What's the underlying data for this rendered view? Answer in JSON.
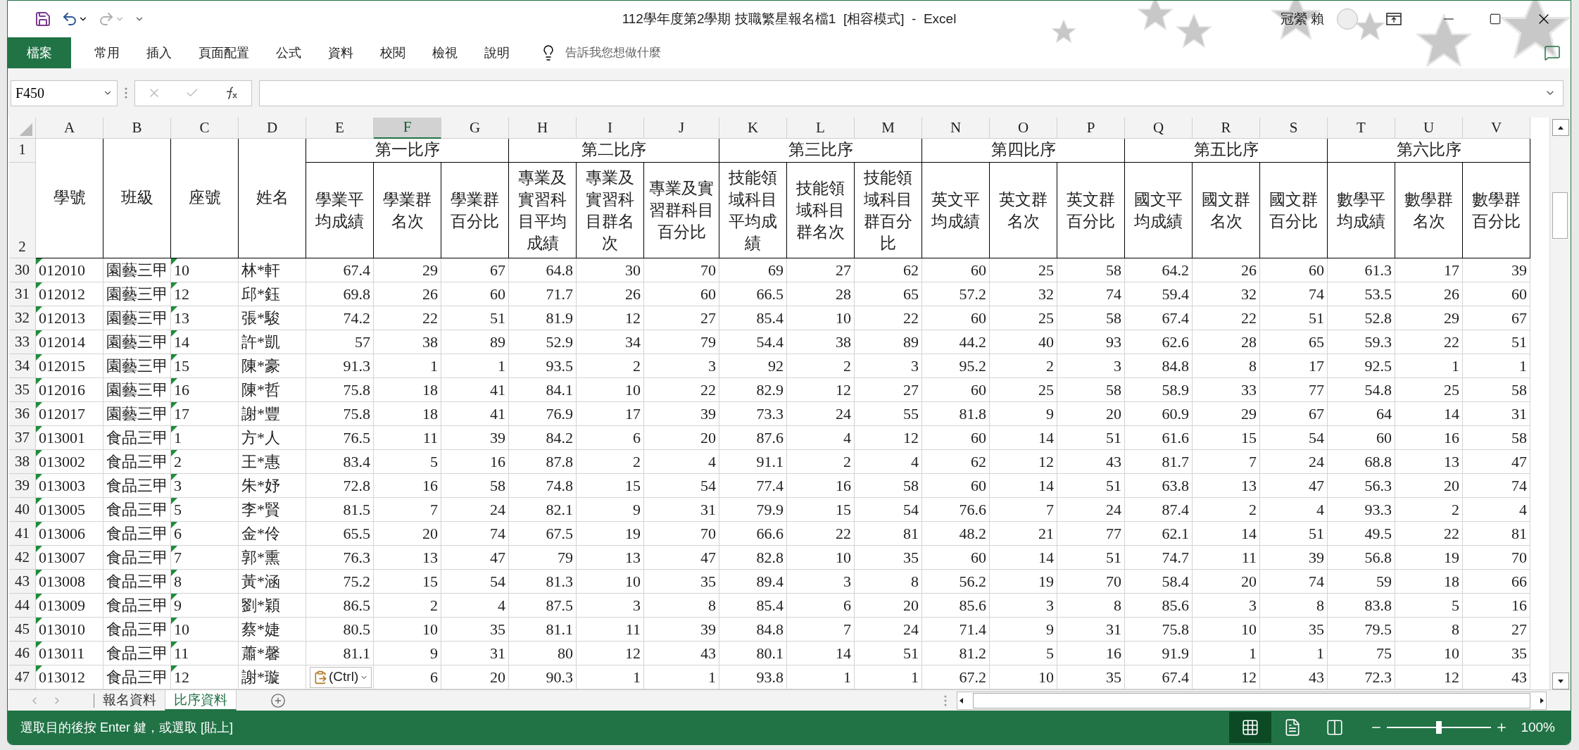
{
  "title_bar": {
    "title": "112學年度第2學期 技職繁星報名檔1  [相容模式]  -  Excel",
    "user": "冠縈 賴"
  },
  "ribbon_tabs": [
    {
      "label": "檔案",
      "kind": "file"
    },
    {
      "label": "常用",
      "kind": "tab"
    },
    {
      "label": "插入",
      "kind": "tab"
    },
    {
      "label": "頁面配置",
      "kind": "tab"
    },
    {
      "label": "公式",
      "kind": "tab"
    },
    {
      "label": "資料",
      "kind": "tab"
    },
    {
      "label": "校閱",
      "kind": "tab"
    },
    {
      "label": "檢視",
      "kind": "tab"
    },
    {
      "label": "說明",
      "kind": "tab"
    }
  ],
  "tell_me": {
    "placeholder": "告訴我您想做什麼"
  },
  "formula_bar": {
    "name_box": "F450"
  },
  "sheet": {
    "columns": [
      {
        "letter": "A",
        "selected": false,
        "kind": "text",
        "flagged": true
      },
      {
        "letter": "B",
        "selected": false,
        "kind": "text",
        "flagged": false
      },
      {
        "letter": "C",
        "selected": false,
        "kind": "text",
        "flagged": true
      },
      {
        "letter": "D",
        "selected": false,
        "kind": "text",
        "flagged": false
      },
      {
        "letter": "E",
        "selected": false,
        "kind": "number",
        "flagged": false
      },
      {
        "letter": "F",
        "selected": true,
        "kind": "number",
        "flagged": false
      },
      {
        "letter": "G",
        "selected": false,
        "kind": "number",
        "flagged": false
      },
      {
        "letter": "H",
        "selected": false,
        "kind": "number",
        "flagged": false
      },
      {
        "letter": "I",
        "selected": false,
        "kind": "number",
        "flagged": false
      },
      {
        "letter": "J",
        "selected": false,
        "kind": "number",
        "flagged": false
      },
      {
        "letter": "K",
        "selected": false,
        "kind": "number",
        "flagged": false
      },
      {
        "letter": "L",
        "selected": false,
        "kind": "number",
        "flagged": false
      },
      {
        "letter": "M",
        "selected": false,
        "kind": "number",
        "flagged": false
      },
      {
        "letter": "N",
        "selected": false,
        "kind": "number",
        "flagged": false
      },
      {
        "letter": "O",
        "selected": false,
        "kind": "number",
        "flagged": false
      },
      {
        "letter": "P",
        "selected": false,
        "kind": "number",
        "flagged": false
      },
      {
        "letter": "Q",
        "selected": false,
        "kind": "number",
        "flagged": false
      },
      {
        "letter": "R",
        "selected": false,
        "kind": "number",
        "flagged": false
      },
      {
        "letter": "S",
        "selected": false,
        "kind": "number",
        "flagged": false
      },
      {
        "letter": "T",
        "selected": false,
        "kind": "number",
        "flagged": false
      },
      {
        "letter": "U",
        "selected": false,
        "kind": "number",
        "flagged": false
      },
      {
        "letter": "V",
        "selected": false,
        "kind": "number",
        "flagged": false
      }
    ],
    "header_row_numbers": [
      "1",
      "2"
    ],
    "fixed_headers": [
      "學號",
      "班級",
      "座號",
      "姓名"
    ],
    "groups": [
      {
        "title": "第一比序",
        "subheaders": [
          "學業平均成績",
          "學業群名次",
          "學業群百分比"
        ]
      },
      {
        "title": "第二比序",
        "subheaders": [
          "專業及實習科目平均成績",
          "專業及實習科目群名次",
          "專業及實習群科目百分比"
        ]
      },
      {
        "title": "第三比序",
        "subheaders": [
          "技能領域科目平均成績",
          "技能領域科目群名次",
          "技能領域科目群百分比"
        ]
      },
      {
        "title": "第四比序",
        "subheaders": [
          "英文平均成績",
          "英文群名次",
          "英文群百分比"
        ]
      },
      {
        "title": "第五比序",
        "subheaders": [
          "國文平均成績",
          "國文群名次",
          "國文群百分比"
        ]
      },
      {
        "title": "第六比序",
        "subheaders": [
          "數學平均成績",
          "數學群名次",
          "數學群百分比"
        ]
      }
    ],
    "rows": [
      {
        "number": "30",
        "cells": [
          "012010",
          "園藝三甲",
          "10",
          "林*軒",
          "67.4",
          "29",
          "67",
          "64.8",
          "30",
          "70",
          "69",
          "27",
          "62",
          "60",
          "25",
          "58",
          "64.2",
          "26",
          "60",
          "61.3",
          "17",
          "39"
        ]
      },
      {
        "number": "31",
        "cells": [
          "012012",
          "園藝三甲",
          "12",
          "邱*鈺",
          "69.8",
          "26",
          "60",
          "71.7",
          "26",
          "60",
          "66.5",
          "28",
          "65",
          "57.2",
          "32",
          "74",
          "59.4",
          "32",
          "74",
          "53.5",
          "26",
          "60"
        ]
      },
      {
        "number": "32",
        "cells": [
          "012013",
          "園藝三甲",
          "13",
          "張*駿",
          "74.2",
          "22",
          "51",
          "81.9",
          "12",
          "27",
          "85.4",
          "10",
          "22",
          "60",
          "25",
          "58",
          "67.4",
          "22",
          "51",
          "52.8",
          "29",
          "67"
        ]
      },
      {
        "number": "33",
        "cells": [
          "012014",
          "園藝三甲",
          "14",
          "許*凱",
          "57",
          "38",
          "89",
          "52.9",
          "34",
          "79",
          "54.4",
          "38",
          "89",
          "44.2",
          "40",
          "93",
          "62.6",
          "28",
          "65",
          "59.3",
          "22",
          "51"
        ]
      },
      {
        "number": "34",
        "cells": [
          "012015",
          "園藝三甲",
          "15",
          "陳*豪",
          "91.3",
          "1",
          "1",
          "93.5",
          "2",
          "3",
          "92",
          "2",
          "3",
          "95.2",
          "2",
          "3",
          "84.8",
          "8",
          "17",
          "92.5",
          "1",
          "1"
        ]
      },
      {
        "number": "35",
        "cells": [
          "012016",
          "園藝三甲",
          "16",
          "陳*哲",
          "75.8",
          "18",
          "41",
          "84.1",
          "10",
          "22",
          "82.9",
          "12",
          "27",
          "60",
          "25",
          "58",
          "58.9",
          "33",
          "77",
          "54.8",
          "25",
          "58"
        ]
      },
      {
        "number": "36",
        "cells": [
          "012017",
          "園藝三甲",
          "17",
          "謝*豐",
          "75.8",
          "18",
          "41",
          "76.9",
          "17",
          "39",
          "73.3",
          "24",
          "55",
          "81.8",
          "9",
          "20",
          "60.9",
          "29",
          "67",
          "64",
          "14",
          "31"
        ]
      },
      {
        "number": "37",
        "cells": [
          "013001",
          "食品三甲",
          "1",
          "方*人",
          "76.5",
          "11",
          "39",
          "84.2",
          "6",
          "20",
          "87.6",
          "4",
          "12",
          "60",
          "14",
          "51",
          "61.6",
          "15",
          "54",
          "60",
          "16",
          "58"
        ]
      },
      {
        "number": "38",
        "cells": [
          "013002",
          "食品三甲",
          "2",
          "王*惠",
          "83.4",
          "5",
          "16",
          "87.8",
          "2",
          "4",
          "91.1",
          "2",
          "4",
          "62",
          "12",
          "43",
          "81.7",
          "7",
          "24",
          "68.8",
          "13",
          "47"
        ]
      },
      {
        "number": "39",
        "cells": [
          "013003",
          "食品三甲",
          "3",
          "朱*妤",
          "72.8",
          "16",
          "58",
          "74.8",
          "15",
          "54",
          "77.4",
          "16",
          "58",
          "60",
          "14",
          "51",
          "63.8",
          "13",
          "47",
          "56.3",
          "20",
          "74"
        ]
      },
      {
        "number": "40",
        "cells": [
          "013005",
          "食品三甲",
          "5",
          "李*賢",
          "81.5",
          "7",
          "24",
          "82.1",
          "9",
          "31",
          "79.9",
          "15",
          "54",
          "76.6",
          "7",
          "24",
          "87.4",
          "2",
          "4",
          "93.3",
          "2",
          "4"
        ]
      },
      {
        "number": "41",
        "cells": [
          "013006",
          "食品三甲",
          "6",
          "金*伶",
          "65.5",
          "20",
          "74",
          "67.5",
          "19",
          "70",
          "66.6",
          "22",
          "81",
          "48.2",
          "21",
          "77",
          "62.1",
          "14",
          "51",
          "49.5",
          "22",
          "81"
        ]
      },
      {
        "number": "42",
        "cells": [
          "013007",
          "食品三甲",
          "7",
          "郭*熏",
          "76.3",
          "13",
          "47",
          "79",
          "13",
          "47",
          "82.8",
          "10",
          "35",
          "60",
          "14",
          "51",
          "74.7",
          "11",
          "39",
          "56.8",
          "19",
          "70"
        ]
      },
      {
        "number": "43",
        "cells": [
          "013008",
          "食品三甲",
          "8",
          "黃*涵",
          "75.2",
          "15",
          "54",
          "81.3",
          "10",
          "35",
          "89.4",
          "3",
          "8",
          "56.2",
          "19",
          "70",
          "58.4",
          "20",
          "74",
          "59",
          "18",
          "66"
        ]
      },
      {
        "number": "44",
        "cells": [
          "013009",
          "食品三甲",
          "9",
          "劉*穎",
          "86.5",
          "2",
          "4",
          "87.5",
          "3",
          "8",
          "85.4",
          "6",
          "20",
          "85.6",
          "3",
          "8",
          "85.6",
          "3",
          "8",
          "83.8",
          "5",
          "16"
        ]
      },
      {
        "number": "45",
        "cells": [
          "013010",
          "食品三甲",
          "10",
          "蔡*婕",
          "80.5",
          "10",
          "35",
          "81.1",
          "11",
          "39",
          "84.8",
          "7",
          "24",
          "71.4",
          "9",
          "31",
          "75.8",
          "10",
          "35",
          "79.5",
          "8",
          "27"
        ]
      },
      {
        "number": "46",
        "cells": [
          "013011",
          "食品三甲",
          "11",
          "蕭*馨",
          "81.1",
          "9",
          "31",
          "80",
          "12",
          "43",
          "80.1",
          "14",
          "51",
          "81.2",
          "5",
          "16",
          "91.9",
          "1",
          "1",
          "75",
          "10",
          "35"
        ]
      },
      {
        "number": "47",
        "cells": [
          "013012",
          "食品三甲",
          "12",
          "謝*璇",
          null,
          "6",
          "20",
          "90.3",
          "1",
          "1",
          "93.8",
          "1",
          "1",
          "67.2",
          "10",
          "35",
          "67.4",
          "12",
          "43",
          "72.3",
          "12",
          "43"
        ]
      }
    ]
  },
  "paste_options": {
    "label": "(Ctrl)"
  },
  "sheet_tabs": [
    {
      "label": "報名資料",
      "selected": false
    },
    {
      "label": "比序資料",
      "selected": true
    }
  ],
  "status_bar": {
    "message": "選取目的後按 Enter 鍵，或選取 [貼上]",
    "views": [
      {
        "kind": "normal",
        "selected": true
      },
      {
        "kind": "page_layout",
        "selected": false
      },
      {
        "kind": "page_break",
        "selected": false
      }
    ],
    "zoom": {
      "level": 0.5,
      "reading": "100%"
    }
  }
}
